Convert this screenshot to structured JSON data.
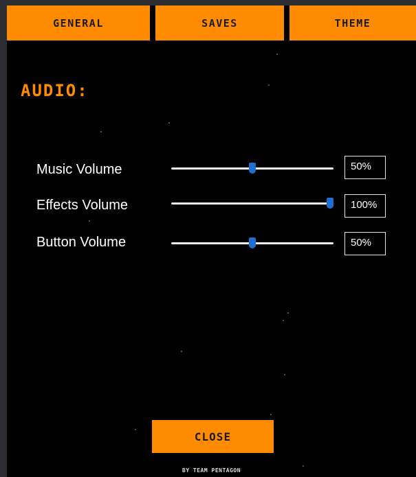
{
  "tabs": [
    {
      "label": "GENERAL"
    },
    {
      "label": "SAVES"
    },
    {
      "label": "THEME"
    }
  ],
  "audio": {
    "heading": "AUDIO:",
    "sliders": [
      {
        "label": "Music Volume",
        "value": 50,
        "display": "50%"
      },
      {
        "label": "Effects Volume",
        "value": 100,
        "display": "100%"
      },
      {
        "label": "Button Volume",
        "value": 50,
        "display": "50%"
      }
    ]
  },
  "close_label": "CLOSE",
  "credit": "BY TEAM PENTAGON",
  "colors": {
    "accent": "#ff8c00",
    "background": "#000000",
    "slider_thumb": "#1f6fd1"
  }
}
